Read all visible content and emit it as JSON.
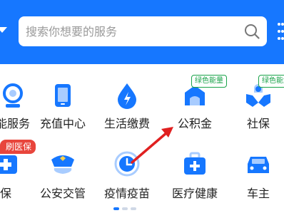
{
  "header": {
    "color": "#1677ff",
    "search": {
      "placeholder": "搜索你想要的服务",
      "icon": "search-icon"
    }
  },
  "services_row1": [
    {
      "label": "能服务",
      "icon": "service-icon"
    },
    {
      "label": "充值中心",
      "icon": "tablet-icon"
    },
    {
      "label": "生活缴费",
      "icon": "utility-drop-icon"
    },
    {
      "label": "公积金",
      "icon": "housing-fund-icon",
      "badge": "绿色能量"
    },
    {
      "label": "社保",
      "icon": "social-security-hands-icon",
      "badge": "绿色能量"
    }
  ],
  "services_row2": [
    {
      "label": "保",
      "icon": "medical-insurance-icon",
      "badge": "刷医保"
    },
    {
      "label": "公安交管",
      "icon": "police-cap-icon"
    },
    {
      "label": "疫情疫苗",
      "icon": "vaccine-clock-icon"
    },
    {
      "label": "医疗健康",
      "icon": "medical-bag-icon"
    },
    {
      "label": "车主",
      "icon": "car-icon"
    }
  ],
  "pager": {
    "pages": 3,
    "active": 1
  },
  "colors": {
    "accent": "#1677ff",
    "icon_light": "#a8ccff",
    "badge_green": "#1aa34a",
    "badge_red": "#e8453c",
    "arrow": "#e02020"
  }
}
